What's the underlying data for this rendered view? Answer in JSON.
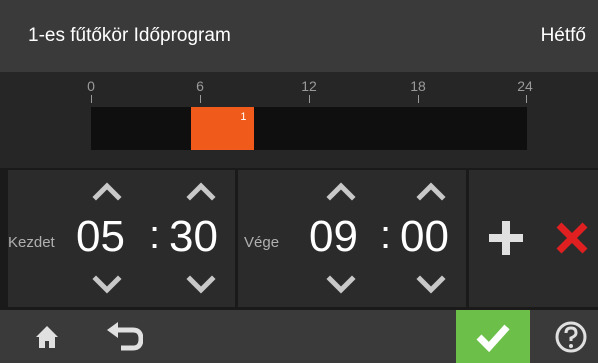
{
  "header": {
    "title": "1-es fűtőkör Időprogram",
    "day": "Hétfő"
  },
  "timeline": {
    "ticks": [
      "0",
      "6",
      "12",
      "18",
      "24"
    ],
    "segment": {
      "label": "1",
      "start_hour": 5.5,
      "end_hour": 9.0,
      "color": "#f05a1a"
    }
  },
  "start": {
    "label": "Kezdet",
    "hour": "05",
    "minute": "30",
    "separator": ":"
  },
  "end": {
    "label": "Vége",
    "hour": "09",
    "minute": "00",
    "separator": ":"
  },
  "actions": {
    "add_icon": "plus-icon",
    "delete_icon": "x-icon",
    "delete_color": "#e02020"
  },
  "bottom": {
    "home_icon": "home-icon",
    "back_icon": "back-arrow-icon",
    "ok_icon": "checkmark-icon",
    "ok_color": "#6cc04a",
    "help_icon": "help-icon"
  }
}
